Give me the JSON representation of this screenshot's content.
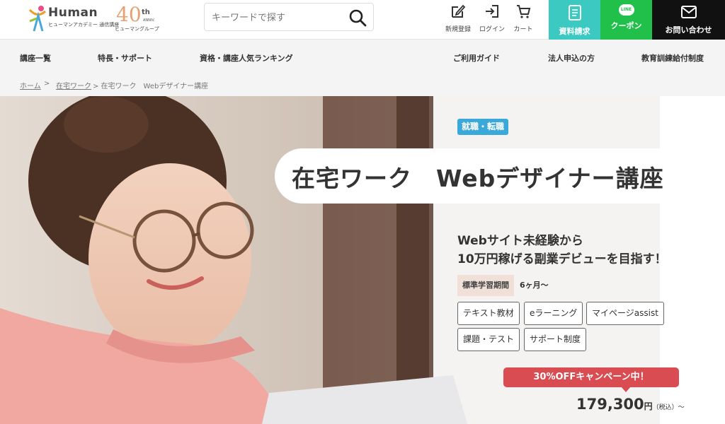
{
  "header": {
    "logo": {
      "brand": "Human",
      "sub": "ヒューマンアカデミー 通信講座"
    },
    "anniv": {
      "num": "40",
      "th": "th",
      "sub": "ANNIV.",
      "group": "ヒューマングループ"
    },
    "search": {
      "placeholder": "キーワードで探す"
    },
    "icons": [
      {
        "name": "edit-icon",
        "label": "新規登録"
      },
      {
        "name": "login-icon",
        "label": "ログイン"
      },
      {
        "name": "cart-icon",
        "label": "カート"
      }
    ],
    "cta": {
      "doc_label": "資料請求",
      "coupon_label": "クーポン",
      "line_text": "LINE",
      "contact_label": "お問い合わせ"
    }
  },
  "nav": {
    "items": [
      "講座一覧",
      "特長・サポート",
      "資格・講座人気ランキング",
      "ご利用ガイド",
      "法人申込の方",
      "教育訓練給付制度"
    ]
  },
  "breadcrumb": {
    "home": "ホーム",
    "sep": ">",
    "category": "在宅ワーク",
    "current": "> 在宅ワーク　Webデザイナー講座"
  },
  "hero": {
    "tag": "就職・転職",
    "title": "在宅ワーク　Webデザイナー講座",
    "lead_line1": "Webサイト未経験から",
    "lead_line2": "10万円稼げる副業デビューを目指す！",
    "period_label": "標準学習期間",
    "period_value": "6ヶ月〜",
    "features": [
      "テキスト教材",
      "eラーニング",
      "マイページassist",
      "課題・テスト",
      "サポート制度"
    ],
    "campaign": "30%OFFキャンペーン中！",
    "price_num": "179,300",
    "price_yen": "円",
    "price_tax": "（税込）〜"
  },
  "colors": {
    "cta_doc": "#3cc9c2",
    "cta_line": "#20c04a",
    "cta_mail": "#111111",
    "tag": "#3aa8d8",
    "campaign": "#d84c52"
  }
}
